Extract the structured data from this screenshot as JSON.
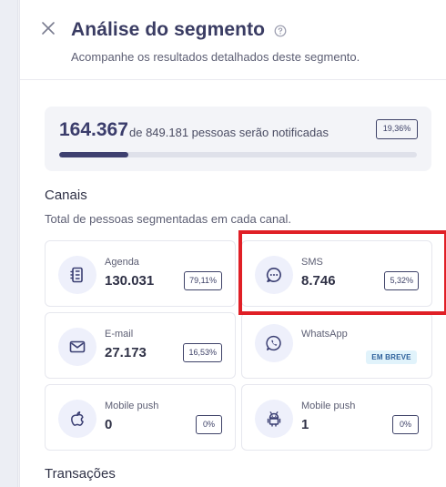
{
  "header": {
    "title": "Análise do segmento",
    "subtitle": "Acompanhe os resultados detalhados deste segmento."
  },
  "summary": {
    "count": "164.367",
    "text": "de 849.181 pessoas serão notificadas",
    "percent": "19,36%",
    "progress": 0.1936
  },
  "channels": {
    "title": "Canais",
    "description": "Total de pessoas segmentadas em cada canal.",
    "items": [
      {
        "label": "Agenda",
        "value": "130.031",
        "percent": "79,11%",
        "icon": "contacts-book-icon"
      },
      {
        "label": "SMS",
        "value": "8.746",
        "percent": "5,32%",
        "icon": "sms-bubble-icon"
      },
      {
        "label": "E-mail",
        "value": "27.173",
        "percent": "16,53%",
        "icon": "mail-icon"
      },
      {
        "label": "WhatsApp",
        "badge": "EM BREVE",
        "icon": "whatsapp-icon"
      },
      {
        "label": "Mobile push",
        "value": "0",
        "percent": "0%",
        "icon": "apple-icon"
      },
      {
        "label": "Mobile push",
        "value": "1",
        "percent": "0%",
        "icon": "android-icon"
      }
    ]
  },
  "transactions": {
    "title": "Transações"
  },
  "colors": {
    "accent": "#3e4070",
    "icon_bg": "#eef0fb",
    "highlight": "#e01f26",
    "badge_bg": "#e1f3fb"
  }
}
